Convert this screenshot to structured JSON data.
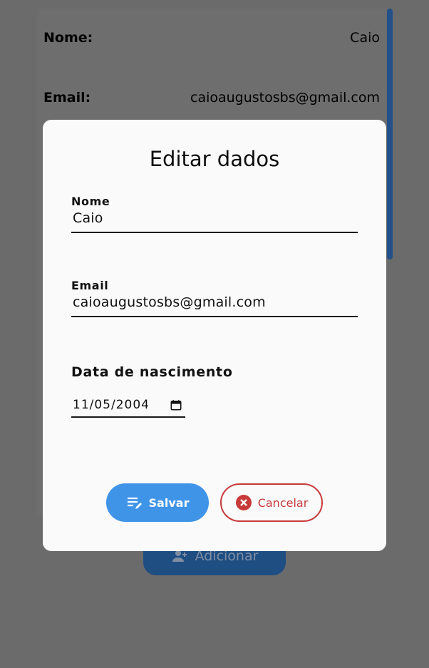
{
  "background_page": {
    "rows": [
      {
        "label": "Nome:",
        "value": "Caio"
      },
      {
        "label": "Email:",
        "value": "caioaugustosbs@gmail.com"
      }
    ],
    "add_button_label": "Adicionar"
  },
  "dialog": {
    "title": "Editar dados",
    "fields": {
      "nome": {
        "label": "Nome",
        "value": "Caio"
      },
      "email": {
        "label": "Email",
        "value": "caioaugustosbs@gmail.com"
      },
      "birthdate": {
        "label": "Data de nascimento",
        "value": "11/05/2004"
      }
    },
    "buttons": {
      "save_label": "Salvar",
      "cancel_label": "Cancelar"
    }
  },
  "colors": {
    "overlay": "#6b6b6b",
    "primary": "#3f94e8",
    "danger": "#c83a3a",
    "dialog_bg": "#fafafa"
  },
  "icons": {
    "save": "playlist-edit-icon",
    "cancel": "close-circle-icon",
    "date": "calendar-icon",
    "add": "add-user-icon"
  }
}
